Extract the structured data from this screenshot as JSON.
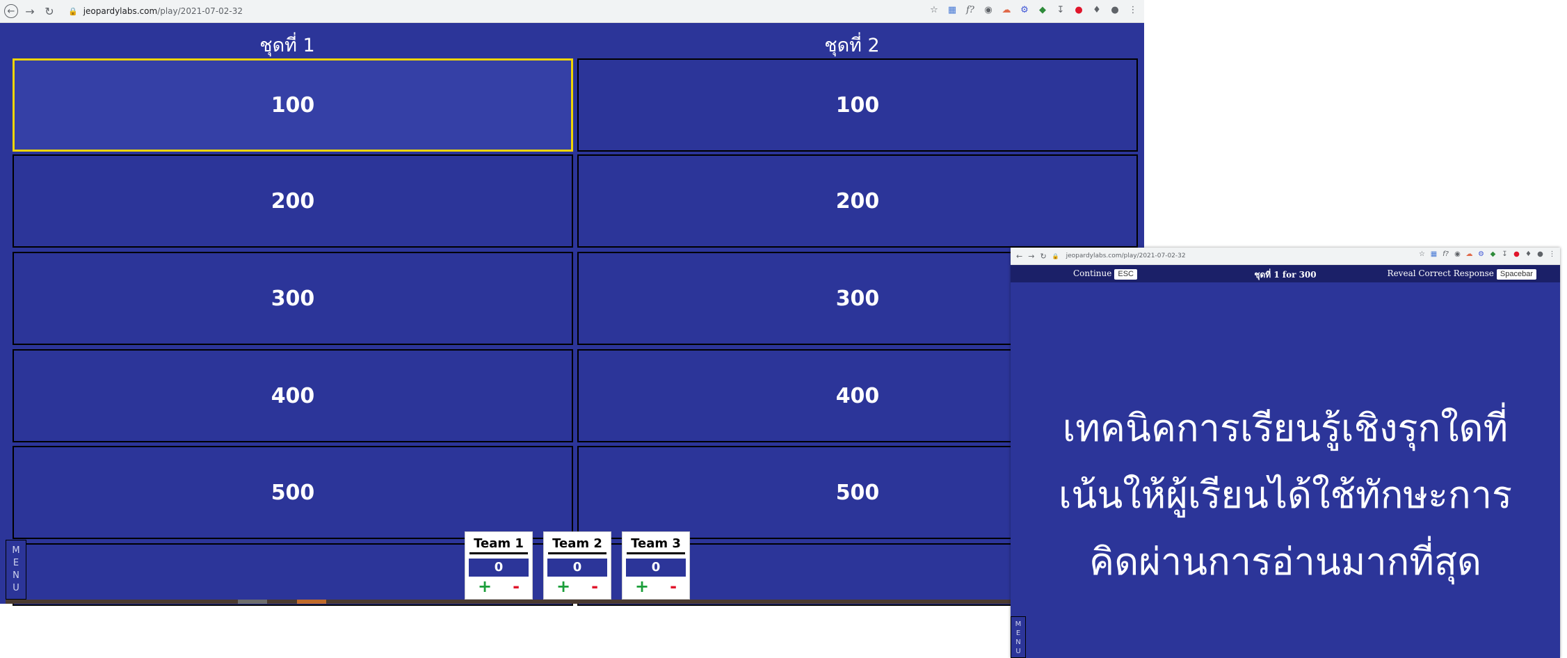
{
  "browser": {
    "url_host": "jeopardylabs.com",
    "url_path": "/play/2021-07-02-32"
  },
  "board": {
    "categories": [
      "ชุดที่ 1",
      "ชุดที่ 2"
    ],
    "column1": [
      "100",
      "200",
      "300",
      "400",
      "500"
    ],
    "column2": [
      "100",
      "200",
      "300",
      "400",
      "500"
    ],
    "selected": "column1 / 100"
  },
  "menu_label": [
    "M",
    "E",
    "N",
    "U"
  ],
  "teams": [
    {
      "name": "Team 1",
      "score": "0",
      "plus": "+",
      "minus": "-"
    },
    {
      "name": "Team 2",
      "score": "0",
      "plus": "+",
      "minus": "-"
    },
    {
      "name": "Team 3",
      "score": "0",
      "plus": "+",
      "minus": "-"
    }
  ],
  "popup": {
    "url": "jeopardylabs.com/play/2021-07-02-32",
    "continue_label": "Continue",
    "continue_key": "ESC",
    "category_line": "ชุดที่ 1 for 300",
    "reveal_label": "Reveal Correct Response",
    "reveal_key": "Spacebar",
    "question_lines": [
      "เทคนิคการเรียนรู้เชิงรุกใดที่",
      "เน้นให้ผู้เรียนได้ใช้ทักษะการ",
      "คิดผ่านการอ่านมากที่สุด"
    ]
  },
  "colors": {
    "board_blue": "#2c3599",
    "selected_border": "#f0d500",
    "plus_green": "#1b9e3a",
    "minus_red": "#e0152b"
  }
}
